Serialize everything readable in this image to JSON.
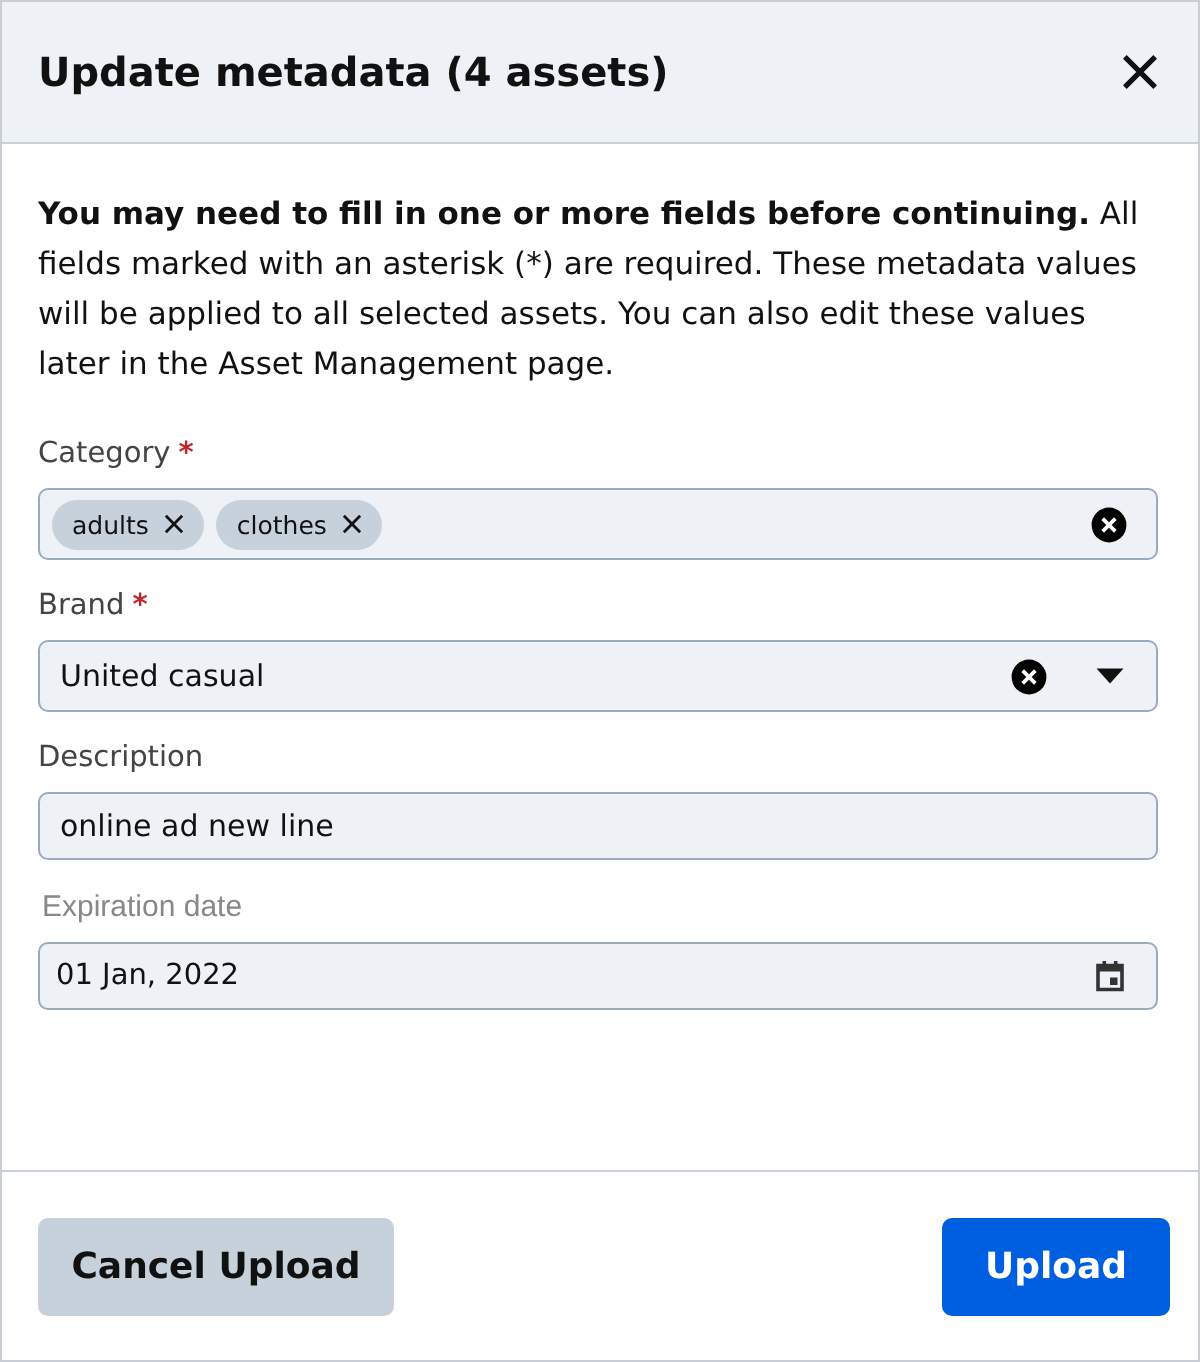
{
  "dialog": {
    "title": "Update metadata (4 assets)"
  },
  "intro": "**You may need to fill in one or more fields before continuing.** All fields marked with an asterisk (*) are required. These metadata values will be applied to all selected assets. You can also edit these values later in the Asset Management page.",
  "fields": [
    {
      "kind": "tags",
      "label": "Category",
      "required_mark": "*",
      "tags": [
        "adults",
        "clothes"
      ]
    },
    {
      "kind": "select",
      "label": "Brand",
      "required_mark": "*",
      "value": "United casual"
    },
    {
      "kind": "text",
      "label": "Description",
      "value": "online ad new line"
    },
    {
      "kind": "date",
      "label": "Expiration date",
      "value": "01 Jan, 2022"
    }
  ],
  "buttons": [
    {
      "label": "Cancel Upload",
      "kind": "secondary"
    },
    {
      "label": "Upload",
      "kind": "primary"
    }
  ]
}
